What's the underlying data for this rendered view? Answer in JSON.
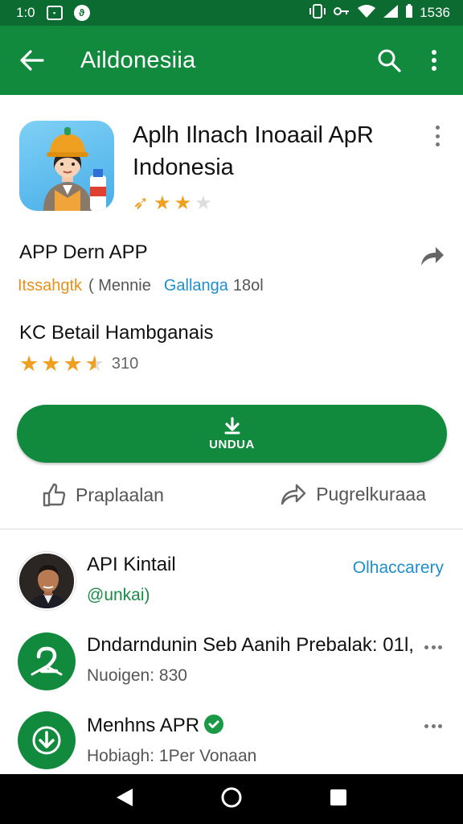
{
  "status_bar": {
    "time": "1:0",
    "right_text": "1536",
    "icons": [
      "message-icon",
      "app-notify-icon",
      "vibrate-icon",
      "wifi-icon",
      "signal-icon",
      "battery-icon"
    ]
  },
  "app_bar": {
    "title": "Aildonesiia",
    "back_icon": "arrow-left-icon",
    "search_icon": "search-icon",
    "menu_icon": "more-vert-icon"
  },
  "app": {
    "name": "Aplh Ilnach Inoaail ApR Indonesia",
    "rating_stars": 2,
    "rating_max": 3,
    "developer_title": "APP Dern APP",
    "tags": {
      "orange": "Itssahgtk",
      "grey": "( Mennie",
      "blue": "Gallanga",
      "grey2": "18ol"
    },
    "subtitle": "KC Betail Hambganais",
    "rating2_value": 3.5,
    "rating2_count": "310",
    "download_label": "UNDUA",
    "action_left": "Praplaalan",
    "action_right": "Pugrelkuraaa"
  },
  "list": [
    {
      "title": "API Kintail",
      "subtitle": "@unkai)",
      "link": "Olhaccarery",
      "avatar": "person-photo"
    },
    {
      "title": "Dndarndunin Seb Aanih Prebalak: 01l,",
      "subtitle": "Nuoigen: 830",
      "avatar": "number-2-icon"
    },
    {
      "title": "Menhns APR",
      "subtitle": "Hobiagh: 1Per Vonaan",
      "avatar": "download-icon",
      "verified_icon": "verified-badge-icon"
    }
  ],
  "colors": {
    "primary": "#128a3e",
    "status_bar": "#0b6b30",
    "accent_orange": "#f0a020",
    "link_blue": "#1f8ecf"
  }
}
